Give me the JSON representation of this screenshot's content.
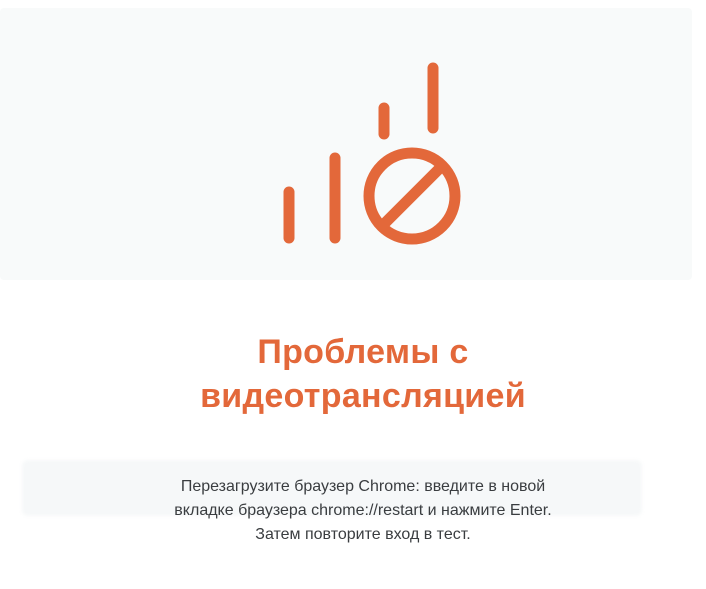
{
  "accent_color": "#e3683a",
  "icon": {
    "name": "no-video-signal-icon"
  },
  "dialog": {
    "title_line1": "Проблемы с",
    "title_line2": "видеотрансляцией",
    "message_line1": "Перезагрузите браузер Chrome: введите в новой",
    "message_line2": "вкладке браузера chrome://restart и нажмите Enter.",
    "message_line3": "Затем повторите вход в тест."
  }
}
